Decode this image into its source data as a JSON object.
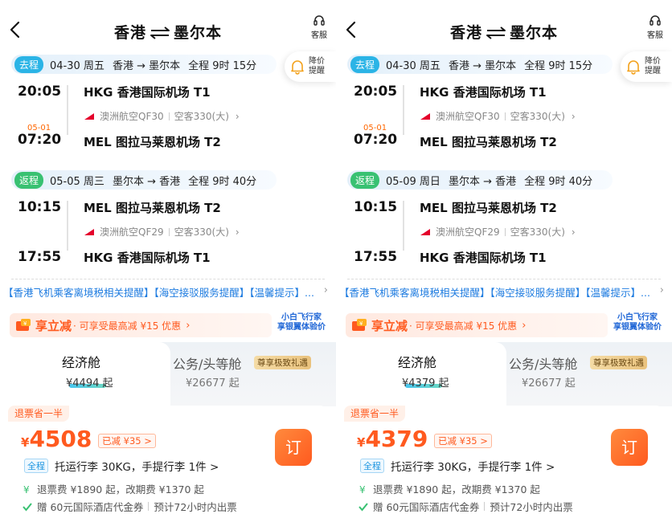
{
  "panels": [
    {
      "header": {
        "from": "香港",
        "to": "墨尔本",
        "service_label": "客服"
      },
      "price_alert": {
        "line1": "降价",
        "line2": "提醒"
      },
      "outbound": {
        "tag": "去程",
        "date": "04-30 周五",
        "route": "香港 → 墨尔本",
        "duration": "全程 9时 15分",
        "dep_time": "20:05",
        "dep_airport": "HKG 香港国际机场 T1",
        "airline": "澳洲航空QF30",
        "aircraft": "空客330(大)",
        "arr_nextday": "05-01",
        "arr_time": "07:20",
        "arr_airport": "MEL 图拉马莱恩机场 T2"
      },
      "return": {
        "tag": "返程",
        "date": "05-05 周三",
        "route": "墨尔本 → 香港",
        "duration": "全程 9时 40分",
        "dep_time": "10:15",
        "dep_airport": "MEL 图拉马莱恩机场 T2",
        "airline": "澳洲航空QF29",
        "aircraft": "空客330(大)",
        "arr_time": "17:55",
        "arr_airport": "HKG 香港国际机场 T1"
      },
      "notice": "【香港飞机乘客离境税相关提醒】【海空接驳服务提醒】【温馨提示】...",
      "promo": {
        "brand": "享立减",
        "text": "· 可享受最高减 ¥15 优惠",
        "side_line1": "小白飞行家",
        "side_line2": "享银翼体验价"
      },
      "cabins": {
        "economy": {
          "name": "经济舱",
          "price": "¥4494 起"
        },
        "business": {
          "name": "公务/头等舱",
          "price": "¥26677 起",
          "badge": "尊享极致礼遇"
        }
      },
      "fare": {
        "refund_tag": "退票省一半",
        "currency": "¥",
        "price": "4508",
        "discount": "已减 ¥35 >",
        "book_label": "订",
        "luggage_tag": "全程",
        "luggage": "托运行李 30KG，手提行李 1件 >",
        "refund_info": "退票费 ¥1890 起，改期费 ¥1370 起",
        "voucher": "赠 60元国际酒店代金券",
        "ticketing": "预计72小时内出票"
      }
    },
    {
      "header": {
        "from": "香港",
        "to": "墨尔本",
        "service_label": "客服"
      },
      "price_alert": {
        "line1": "降价",
        "line2": "提醒"
      },
      "outbound": {
        "tag": "去程",
        "date": "04-30 周五",
        "route": "香港 → 墨尔本",
        "duration": "全程 9时 15分",
        "dep_time": "20:05",
        "dep_airport": "HKG 香港国际机场 T1",
        "airline": "澳洲航空QF30",
        "aircraft": "空客330(大)",
        "arr_nextday": "05-01",
        "arr_time": "07:20",
        "arr_airport": "MEL 图拉马莱恩机场 T2"
      },
      "return": {
        "tag": "返程",
        "date": "05-09 周日",
        "route": "墨尔本 → 香港",
        "duration": "全程 9时 40分",
        "dep_time": "10:15",
        "dep_airport": "MEL 图拉马莱恩机场 T2",
        "airline": "澳洲航空QF29",
        "aircraft": "空客330(大)",
        "arr_time": "17:55",
        "arr_airport": "HKG 香港国际机场 T1"
      },
      "notice": "【香港飞机乘客离境税相关提醒】【海空接驳服务提醒】【温馨提示】...",
      "promo": {
        "brand": "享立减",
        "text": "· 可享受最高减 ¥15 优惠",
        "side_line1": "小白飞行家",
        "side_line2": "享银翼体验价"
      },
      "cabins": {
        "economy": {
          "name": "经济舱",
          "price": "¥4379 起"
        },
        "business": {
          "name": "公务/头等舱",
          "price": "¥26677 起",
          "badge": "尊享极致礼遇"
        }
      },
      "fare": {
        "refund_tag": "退票省一半",
        "currency": "¥",
        "price": "4379",
        "discount": "已减 ¥35 >",
        "book_label": "订",
        "luggage_tag": "全程",
        "luggage": "托运行李 30KG，手提行李 1件 >",
        "refund_info": "退票费 ¥1890 起，改期费 ¥1370 起",
        "voucher": "赠 60元国际酒店代金券",
        "ticketing": "预计72小时内出票"
      }
    }
  ],
  "colors": {
    "accent": "#ff5a1f",
    "blue_tag": "#2bb4e6",
    "green_tag": "#38c172",
    "link": "#1f7ce0"
  }
}
